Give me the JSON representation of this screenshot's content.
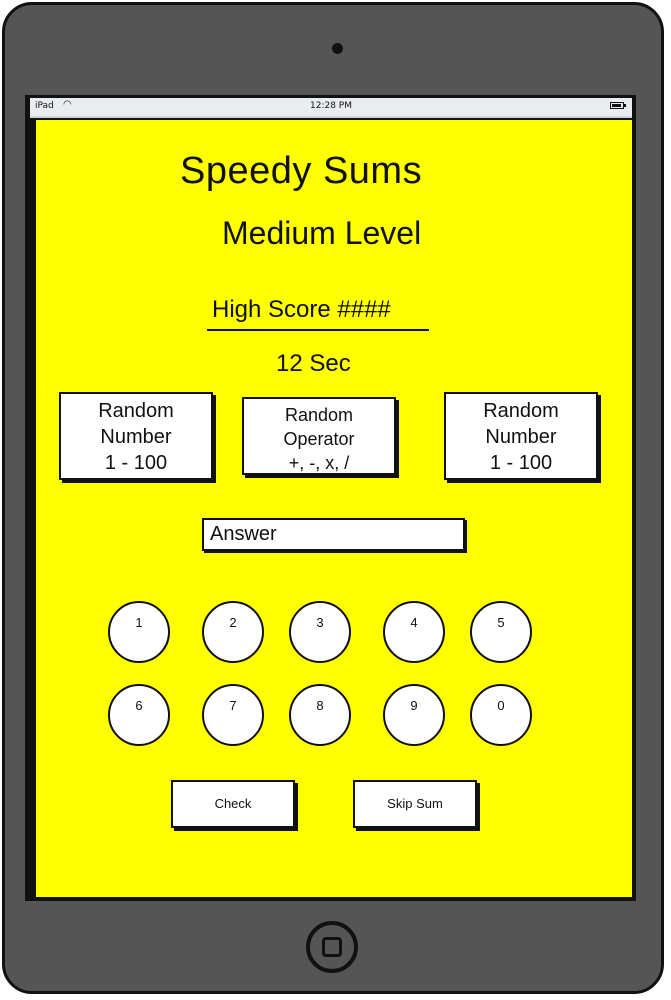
{
  "status_bar": {
    "carrier": "iPad",
    "time": "12:28 PM"
  },
  "app": {
    "title": "Speedy Sums",
    "level": "Medium Level",
    "high_score": "High Score ####",
    "timer": "12 Sec"
  },
  "operands": {
    "left": {
      "line1": "Random",
      "line2": "Number",
      "line3": "1 - 100"
    },
    "operator": {
      "line1": "Random",
      "line2": "Operator",
      "line3": "+, -, x, /"
    },
    "right": {
      "line1": "Random",
      "line2": "Number",
      "line3": "1 - 100"
    }
  },
  "answer_field": {
    "value": "Answer"
  },
  "keypad": {
    "keys": [
      "1",
      "2",
      "3",
      "4",
      "5",
      "6",
      "7",
      "8",
      "9",
      "0"
    ]
  },
  "actions": {
    "check": "Check",
    "skip": "Skip Sum"
  },
  "colors": {
    "background": "#ffff00",
    "device_frame": "#555555"
  }
}
